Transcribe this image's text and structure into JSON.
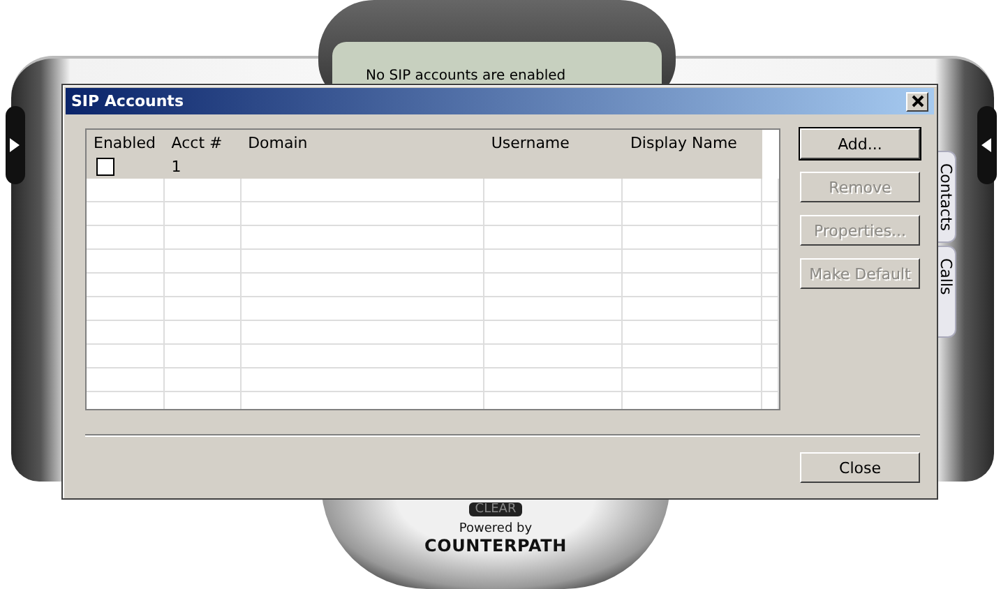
{
  "phone": {
    "status": "No SIP accounts are enabled",
    "clear_key": "CLEAR",
    "powered_by": "Powered by",
    "brand": "COUNTERPATH",
    "side_tabs": [
      {
        "label": "Contacts"
      },
      {
        "label": "Calls"
      }
    ]
  },
  "dialog": {
    "title": "SIP Accounts",
    "table": {
      "columns": [
        "Enabled",
        "Acct #",
        "Domain",
        "Username",
        "Display Name"
      ],
      "rows": [
        {
          "enabled": false,
          "acct": "1"
        }
      ]
    },
    "buttons": [
      {
        "label": "Add...",
        "disabled": false,
        "default": true
      },
      {
        "label": "Remove",
        "disabled": true,
        "default": false
      },
      {
        "label": "Properties...",
        "disabled": true,
        "default": false
      },
      {
        "label": "Make Default",
        "disabled": true,
        "default": false
      }
    ],
    "close": "Close"
  }
}
